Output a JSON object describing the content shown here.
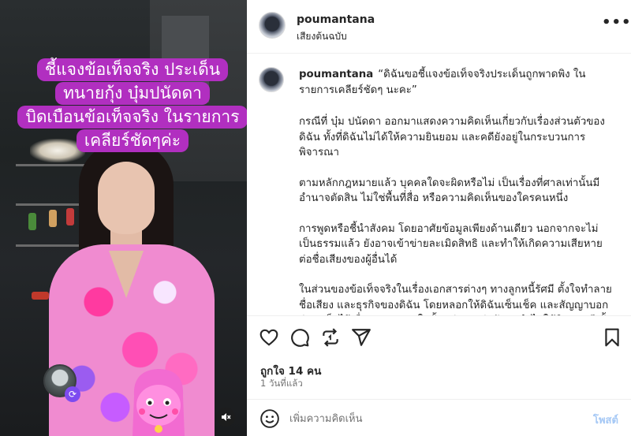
{
  "media": {
    "overlay_caption_lines": [
      "ชี้แจงข้อเท็จจริง ประเด็น",
      "ทนายกุ้ง บุ๋มปนัดดา",
      "บิดเบือนข้อเท็จจริง ในรายการ",
      "เคลียร์ชัดๆค่ะ"
    ],
    "mute_icon": "speaker-muted-icon"
  },
  "post": {
    "username": "poumantana",
    "audio_label": "เสียงต้นฉบับ",
    "more_icon": "more-horizontal-icon"
  },
  "caption": {
    "username": "poumantana",
    "paragraphs": [
      "“ดิฉันขอชี้แจงข้อเท็จจริงประเด็นถูกพาดพิง ในรายการเคลียร์ชัดๆ นะคะ”",
      "กรณีที่ บุ๋ม ปนัดดา ออกมาแสดงความคิดเห็นเกี่ยวกับเรื่องส่วนตัวของดิฉัน ทั้งที่ดิฉันไม่ได้ให้ความยินยอม และคดียังอยู่ในกระบวนการพิจารณา",
      "ตามหลักกฎหมายแล้ว บุคคลใดจะผิดหรือไม่ เป็นเรื่องที่ศาลเท่านั้นมีอำนาจตัดสิน ไม่ใช่พื้นที่สื่อ หรือความคิดเห็นของใครคนหนึ่ง",
      "การพูดหรือชี้นำสังคม โดยอาศัยข้อมูลเพียงด้านเดียว นอกจากจะไม่เป็นธรรมแล้ว ยังอาจเข้าข่ายละเมิดสิทธิ และทำให้เกิดความเสียหายต่อชื่อเสียงของผู้อื่นได้",
      "ในส่วนของข้อเท็จจริงในเรื่องเอกสารต่างๆ ทางลูกหนี้รัศมี ตั้งใจทำลายชื่อเสียง และธุรกิจของดิฉัน โดยหลอกให้ดิฉันเซ็นเช็ค และสัญญาบอกว่าจะเก็บไว้เพื่อความสบายใจทั้ง 2ฝ่าย แต่กลับถูกนำไปใช้บิดรูปคดี ทั้ง"
    ]
  },
  "actions": {
    "like_icon": "heart-icon",
    "comment_icon": "comment-icon",
    "repost_icon": "repost-icon",
    "share_icon": "send-icon",
    "save_icon": "bookmark-icon"
  },
  "stats": {
    "likes_text": "ถูกใจ 14 คน",
    "time_text": "1 วันที่แล้ว"
  },
  "comment_box": {
    "placeholder": "เพิ่มความคิดเห็น",
    "post_label": "โพสต์",
    "emoji_icon": "emoji-icon"
  }
}
